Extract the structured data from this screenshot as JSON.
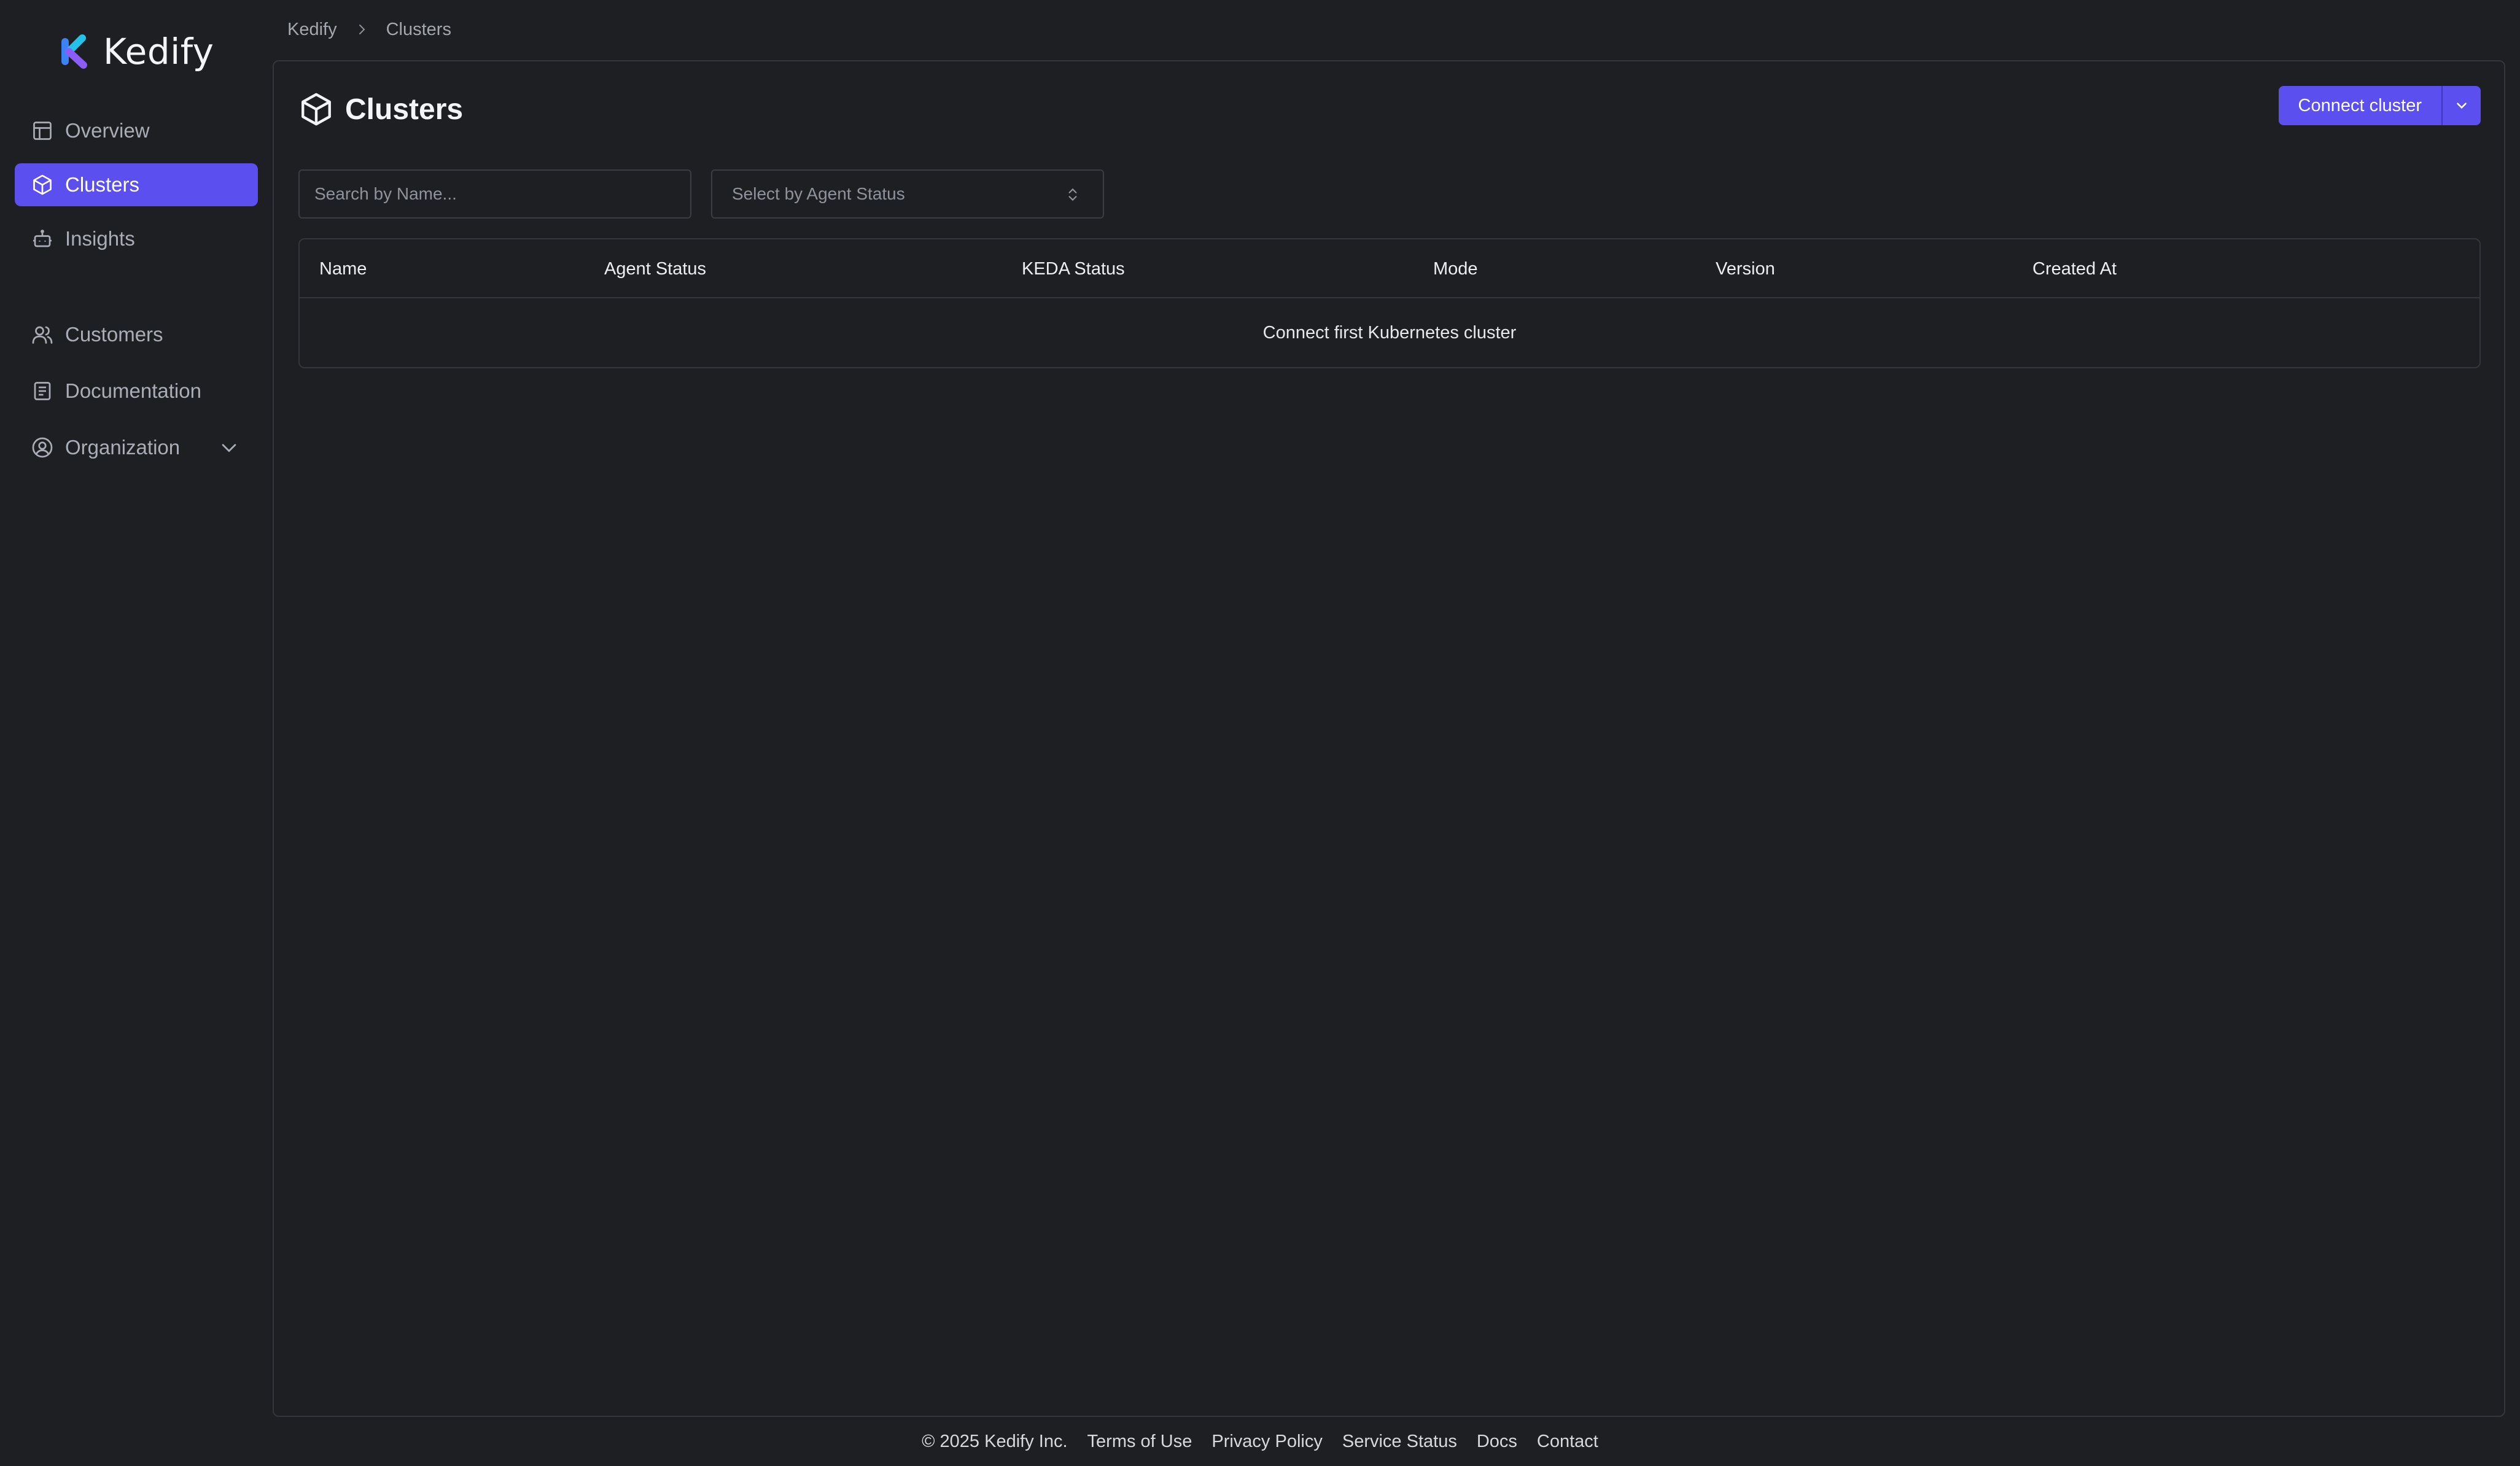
{
  "app": {
    "brand": "Kedify"
  },
  "sidebar": {
    "items": [
      {
        "label": "Overview",
        "icon": "layout-icon"
      },
      {
        "label": "Clusters",
        "icon": "cube-icon",
        "active": true
      },
      {
        "label": "Insights",
        "icon": "bot-icon"
      },
      {
        "label": "Customers",
        "icon": "users-icon"
      },
      {
        "label": "Documentation",
        "icon": "book-icon"
      },
      {
        "label": "Organization",
        "icon": "user-circle-icon",
        "expandable": true
      }
    ]
  },
  "breadcrumb": {
    "items": [
      "Kedify",
      "Clusters"
    ]
  },
  "main": {
    "title": "Clusters",
    "connect_button": "Connect cluster",
    "search": {
      "placeholder": "Search by Name..."
    },
    "status_filter": {
      "placeholder": "Select by Agent Status"
    },
    "table": {
      "columns": [
        "Name",
        "Agent Status",
        "KEDA Status",
        "Mode",
        "Version",
        "Created At"
      ],
      "empty_message": "Connect first Kubernetes cluster"
    }
  },
  "footer": {
    "copyright": "© 2025 Kedify Inc.",
    "links": [
      "Terms of Use",
      "Privacy Policy",
      "Service Status",
      "Docs",
      "Contact"
    ]
  },
  "colors": {
    "background": "#1d1f23",
    "accent": "#5b4ff0",
    "border": "#33363c"
  }
}
